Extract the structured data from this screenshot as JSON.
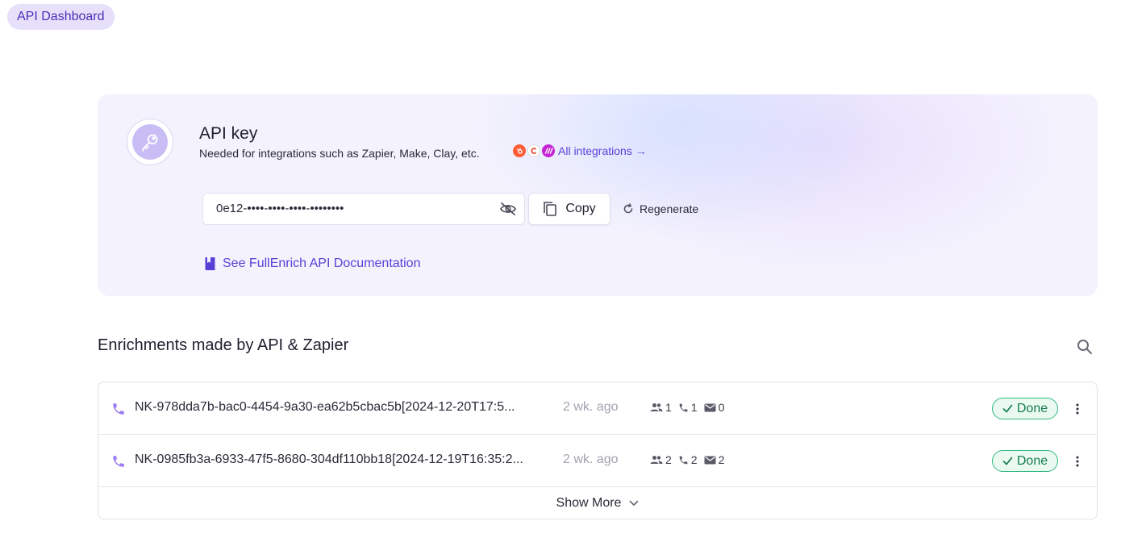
{
  "header": {
    "tab_label": "API Dashboard"
  },
  "api_card": {
    "title": "API key",
    "subtitle": "Needed for integrations such as Zapier, Make, Clay, etc.",
    "integrations_link": "All integrations →",
    "integration_icons": [
      "hubspot-icon",
      "clay-icon",
      "make-icon"
    ],
    "key_value": "0e12-••••-••••-••••-••••••••",
    "copy_label": "Copy",
    "regenerate_label": "Regenerate",
    "docs_link": "See FullEnrich API Documentation"
  },
  "enrichments": {
    "title": "Enrichments made by API & Zapier",
    "rows": [
      {
        "name": "NK-978dda7b-bac0-4454-9a30-ea62b5cbac5b[2024-12-20T17:5...",
        "age": "2 wk. ago",
        "contacts": "1",
        "phones": "1",
        "emails": "0",
        "status": "Done"
      },
      {
        "name": "NK-0985fb3a-6933-47f5-8680-304df110bb18[2024-12-19T16:35:2...",
        "age": "2 wk. ago",
        "contacts": "2",
        "phones": "2",
        "emails": "2",
        "status": "Done"
      }
    ],
    "show_more_label": "Show More"
  },
  "colors": {
    "accent": "#5a3fd6",
    "status_done": "#147a4e",
    "card_bg": "#f4f2fd"
  }
}
